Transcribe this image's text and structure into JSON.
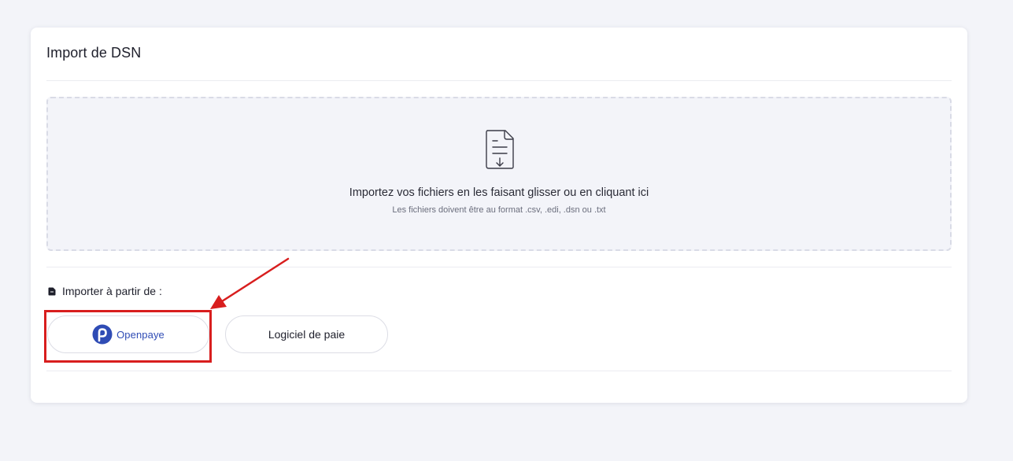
{
  "card": {
    "title": "Import de DSN"
  },
  "dropzone": {
    "icon": "file-download-icon",
    "main_text": "Importez vos fichiers en les faisant glisser ou en cliquant ici",
    "sub_text": "Les fichiers doivent être au format .csv, .edi, .dsn ou .txt"
  },
  "import_from": {
    "label": "Importer à partir de :",
    "icon": "file-icon"
  },
  "sources": {
    "openpaye": {
      "label": "Openpaye",
      "icon": "openpaye-logo-icon",
      "brand_color": "#2f4cb5"
    },
    "logiciel": {
      "label": "Logiciel de paie"
    }
  },
  "annotation": {
    "color": "#d81e1e"
  }
}
